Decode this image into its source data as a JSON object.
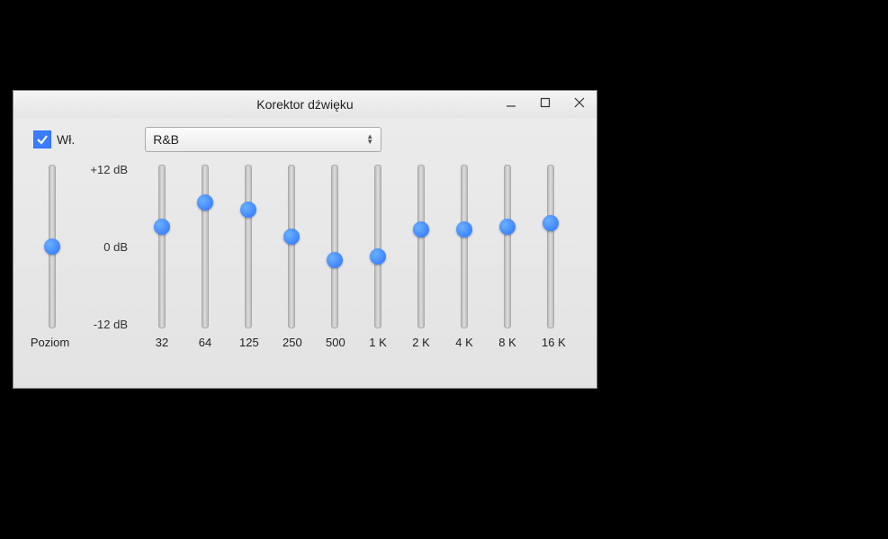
{
  "window": {
    "title": "Korektor dźwięku"
  },
  "controls": {
    "on_checked": true,
    "on_label": "Wł.",
    "preset": "R&B"
  },
  "scale": {
    "max": "+12 dB",
    "mid": "0 dB",
    "min": "-12 dB"
  },
  "preamp": {
    "label": "Poziom",
    "value": 0
  },
  "bands": [
    {
      "label": "32",
      "value": 3.0
    },
    {
      "label": "64",
      "value": 6.5
    },
    {
      "label": "125",
      "value": 5.5
    },
    {
      "label": "250",
      "value": 1.5
    },
    {
      "label": "500",
      "value": -2.0
    },
    {
      "label": "1 K",
      "value": -1.5
    },
    {
      "label": "2 K",
      "value": 2.5
    },
    {
      "label": "4 K",
      "value": 2.5
    },
    {
      "label": "8 K",
      "value": 3.0
    },
    {
      "label": "16 K",
      "value": 3.5
    }
  ],
  "chart_data": {
    "type": "bar",
    "categories": [
      "32",
      "64",
      "125",
      "250",
      "500",
      "1 K",
      "2 K",
      "4 K",
      "8 K",
      "16 K"
    ],
    "values": [
      3.0,
      6.5,
      5.5,
      1.5,
      -2.0,
      -1.5,
      2.5,
      2.5,
      3.0,
      3.5
    ],
    "ylabel": "dB",
    "ylim": [
      -12,
      12
    ],
    "title": "Korektor dźwięku — R&B"
  }
}
